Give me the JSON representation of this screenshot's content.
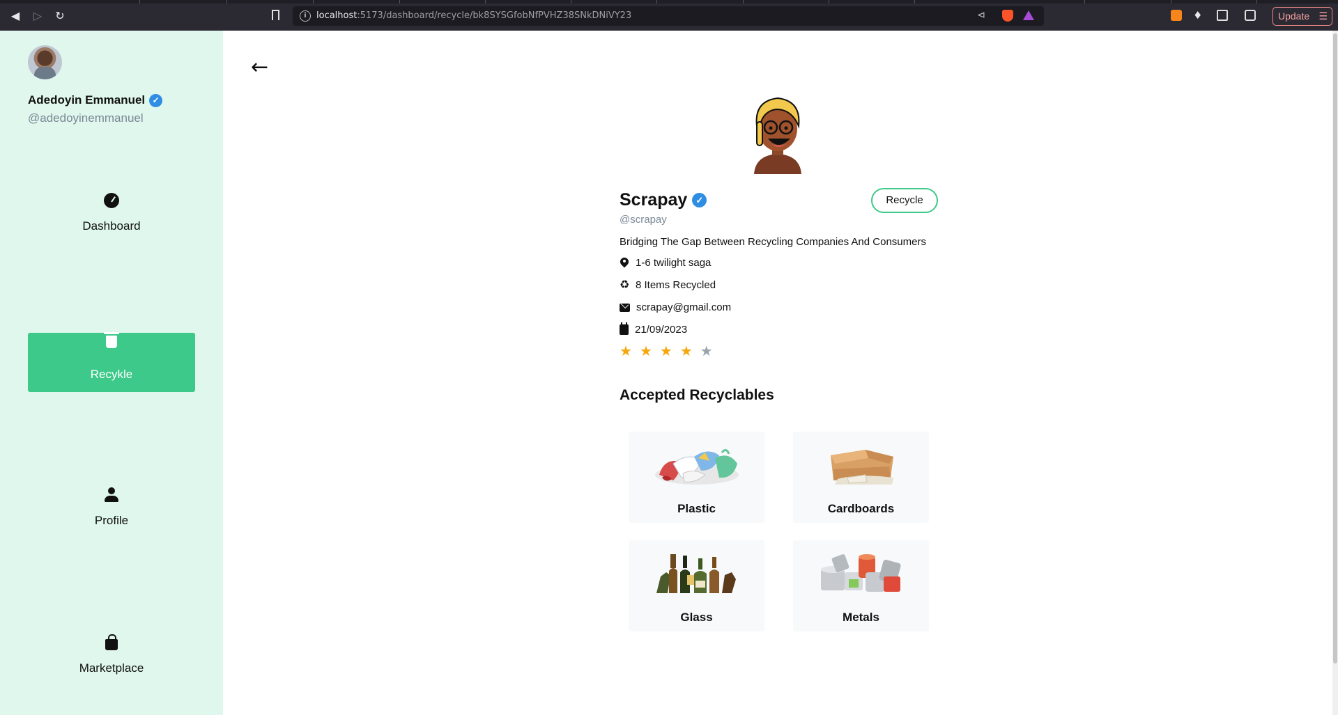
{
  "browser": {
    "url_host": "localhost",
    "url_path": ":5173/dashboard/recycle/bk8SYSGfobNfPVHZ38SNkDNiVY23",
    "update_label": "Update",
    "menu_glyph": "☰"
  },
  "user": {
    "name": "Adedoyin Emmanuel",
    "handle": "@adedoyinemmanuel"
  },
  "sidebar": {
    "items": [
      {
        "label": "Dashboard",
        "icon": "dashboard-gauge-icon",
        "active": false
      },
      {
        "label": "Recykle",
        "icon": "trash-icon",
        "active": true
      },
      {
        "label": "Profile",
        "icon": "person-icon",
        "active": false
      },
      {
        "label": "Marketplace",
        "icon": "shopping-bag-icon",
        "active": false
      }
    ]
  },
  "org": {
    "name": "Scrapay",
    "handle": "@scrapay",
    "tagline": "Bridging The Gap Between Recycling Companies And Consumers",
    "location": "1-6 twilight saga",
    "items_recycled": "8 Items Recycled",
    "email": "scrapay@gmail.com",
    "date": "21/09/2023",
    "rating": 4,
    "rating_max": 5,
    "recycle_button": "Recycle"
  },
  "recyclables": {
    "title": "Accepted Recyclables",
    "items": [
      {
        "label": "Plastic"
      },
      {
        "label": "Cardboards"
      },
      {
        "label": "Glass"
      },
      {
        "label": "Metals"
      }
    ]
  },
  "colors": {
    "sidebar_bg": "#dff7ec",
    "accent": "#3cc98a",
    "star": "#f5a70c",
    "verified": "#2f8de4"
  }
}
